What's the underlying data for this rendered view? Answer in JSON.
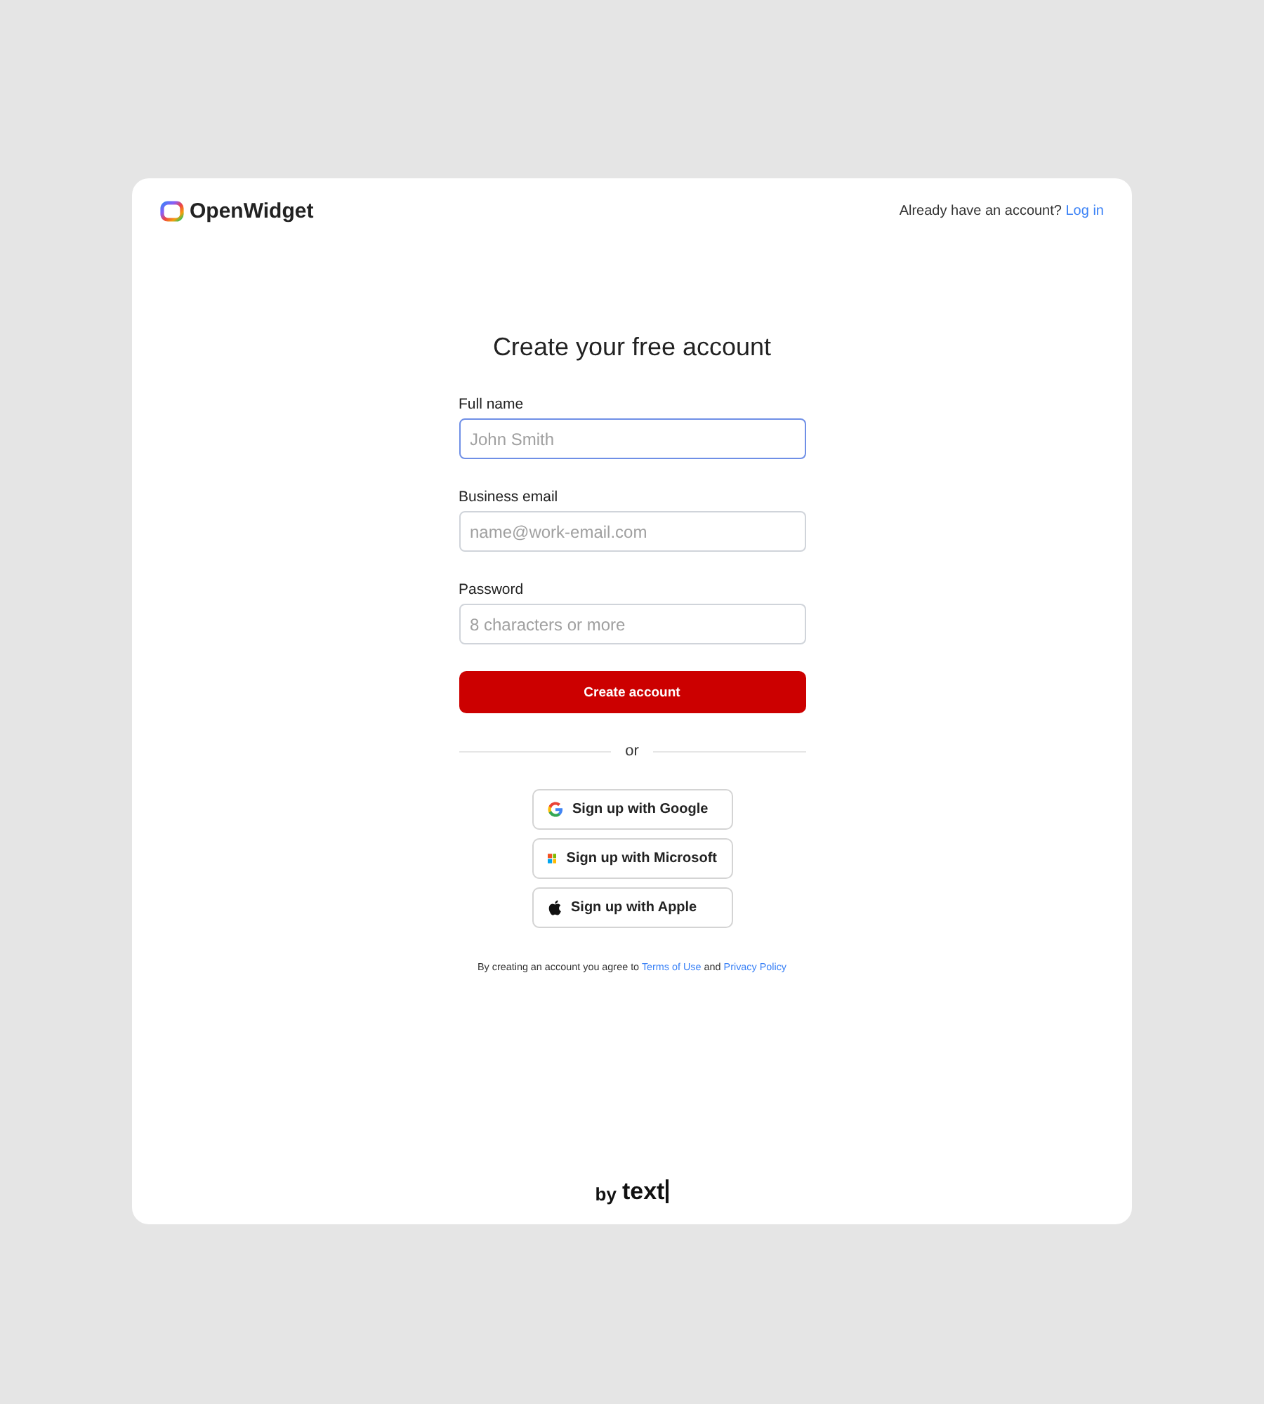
{
  "header": {
    "brand": "OpenWidget",
    "prompt": "Already have an account?",
    "login_link": "Log in"
  },
  "title": "Create your free account",
  "fields": [
    {
      "label": "Full name",
      "placeholder": "John Smith",
      "focused": true
    },
    {
      "label": "Business email",
      "placeholder": "name@work-email.com",
      "focused": false
    },
    {
      "label": "Password",
      "placeholder": "8 characters or more",
      "focused": false
    }
  ],
  "submit": "Create account",
  "divider": "or",
  "social": [
    {
      "kind": "google",
      "label": "Sign up with Google"
    },
    {
      "kind": "microsoft",
      "label": "Sign up with Microsoft"
    },
    {
      "kind": "apple",
      "label": "Sign up with Apple"
    }
  ],
  "legal": {
    "prefix": "By creating an account you agree to",
    "terms": "Terms of Use",
    "joiner": "and",
    "privacy": "Privacy Policy"
  },
  "footer": {
    "by": "by",
    "brand": "text"
  }
}
